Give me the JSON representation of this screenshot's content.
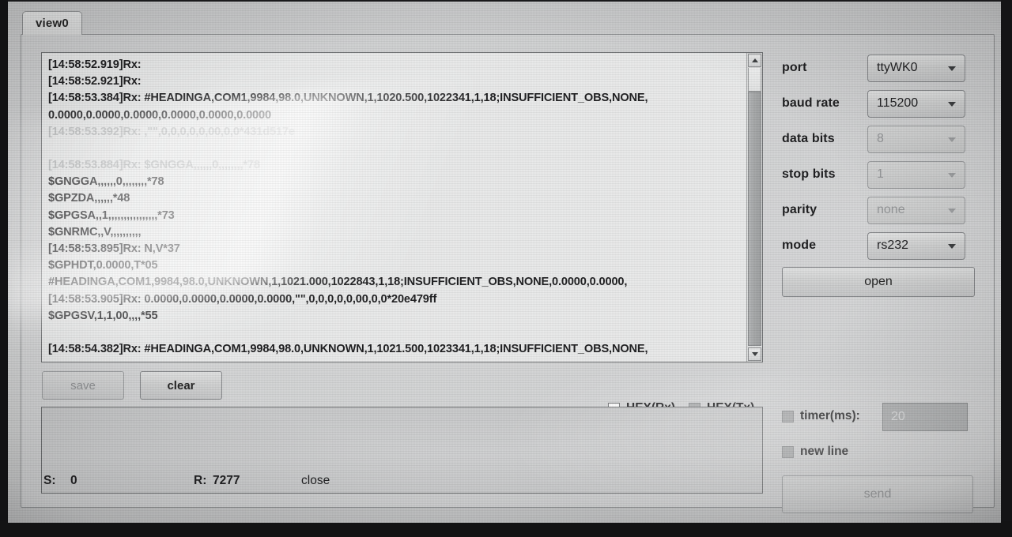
{
  "window": {
    "tabs": [
      {
        "label": "view0",
        "active": true
      }
    ]
  },
  "log": {
    "lines": [
      {
        "text": "[14:58:52.919]Rx:",
        "style": "normal"
      },
      {
        "text": "[14:58:52.921]Rx:",
        "style": "normal"
      },
      {
        "text": "[14:58:53.384]Rx: #HEADINGA,COM1,9984,98.0,UNKNOWN,1,1020.500,1022341,1,18;INSUFFICIENT_OBS,NONE,",
        "style": "normal"
      },
      {
        "text": "0.0000,0.0000,0.0000,0.0000,0.0000,0.0000",
        "style": "normal"
      },
      {
        "text": "[14:58:53.392]Rx: ,\"\",0,0,0,0,0,00,0,0*431d517e",
        "style": "glare"
      },
      {
        "text": "",
        "style": "blank"
      },
      {
        "text": "[14:58:53.884]Rx: $GNGGA,,,,,,0,,,,,,,,*78",
        "style": "glare"
      },
      {
        "text": "$GNGGA,,,,,,0,,,,,,,,*78",
        "style": "normal"
      },
      {
        "text": "$GPZDA,,,,,,*48",
        "style": "normal"
      },
      {
        "text": "$GPGSA,,1,,,,,,,,,,,,,,,,*73",
        "style": "normal"
      },
      {
        "text": "$GNRMC,,V,,,,,,,,,,",
        "style": "normal"
      },
      {
        "text": "[14:58:53.895]Rx: N,V*37",
        "style": "normal"
      },
      {
        "text": "$GPHDT,0.0000,T*05",
        "style": "normal"
      },
      {
        "text": "#HEADINGA,COM1,9984,98.0,UNKNOWN,1,1021.000,1022843,1,18;INSUFFICIENT_OBS,NONE,0.0000,0.0000,",
        "style": "normal"
      },
      {
        "text": "[14:58:53.905]Rx: 0.0000,0.0000,0.0000,0.0000,\"\",0,0,0,0,0,00,0,0*20e479ff",
        "style": "normal"
      },
      {
        "text": "$GPGSV,1,1,00,,,,*55",
        "style": "normal"
      },
      {
        "text": "",
        "style": "blank"
      },
      {
        "text": "[14:58:54.382]Rx: #HEADINGA,COM1,9984,98.0,UNKNOWN,1,1021.500,1023341,1,18;INSUFFICIENT_OBS,NONE,",
        "style": "normal"
      }
    ]
  },
  "toolbar": {
    "save_label": "save",
    "clear_label": "clear"
  },
  "send": {
    "value": "",
    "placeholder": ""
  },
  "options": {
    "hex_rx_label": "HEX(Rx)",
    "hex_rx_checked": false,
    "hex_tx_label": "HEX(Tx)",
    "hex_tx_checked": false,
    "timer_label": "timer(ms):",
    "timer_checked": false,
    "timer_value": "20",
    "newline_label": "new line",
    "newline_checked": false,
    "send_label": "send"
  },
  "status": {
    "sent_label": "S:",
    "sent_value": "0",
    "received_label": "R:",
    "received_value": "7277",
    "connection_state": "close"
  },
  "settings": {
    "port": {
      "label": "port",
      "value": "ttyWK0",
      "enabled": true
    },
    "baud_rate": {
      "label": "baud rate",
      "value": "115200",
      "enabled": true
    },
    "data_bits": {
      "label": "data bits",
      "value": "8",
      "enabled": false
    },
    "stop_bits": {
      "label": "stop bits",
      "value": "1",
      "enabled": false
    },
    "parity": {
      "label": "parity",
      "value": "none",
      "enabled": false
    },
    "mode": {
      "label": "mode",
      "value": "rs232",
      "enabled": true
    },
    "open_label": "open"
  },
  "colors": {
    "panel_bg": "#d2d3d4",
    "log_bg": "#e9eaea",
    "text": "#1d1d1f",
    "disabled_text": "#949698",
    "border": "#85878a"
  }
}
